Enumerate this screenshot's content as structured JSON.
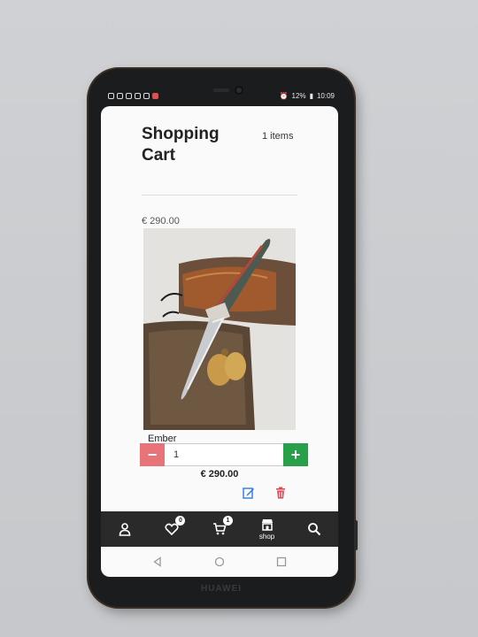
{
  "status_bar": {
    "battery": "12%",
    "time": "10:09"
  },
  "cart": {
    "title": "Shopping Cart",
    "item_count": "1 items",
    "total": "€ 290.00"
  },
  "item": {
    "name": "Ember",
    "quantity": "1",
    "price": "€ 290.00",
    "minus_label": "−",
    "plus_label": "+"
  },
  "bottom_nav": {
    "items": [
      {
        "icon": "user-icon",
        "label": "",
        "badge": ""
      },
      {
        "icon": "heart-icon",
        "label": "",
        "badge": "0"
      },
      {
        "icon": "cart-icon",
        "label": "",
        "badge": "1"
      },
      {
        "icon": "shop-icon",
        "label": "shop",
        "badge": ""
      },
      {
        "icon": "search-icon",
        "label": "",
        "badge": ""
      }
    ]
  },
  "device": {
    "brand": "HUAWEI"
  },
  "colors": {
    "minus": "#e8747a",
    "plus": "#28a04a",
    "nav_bg": "#2a2a2a",
    "edit": "#2d7be0",
    "delete": "#e04b55"
  }
}
